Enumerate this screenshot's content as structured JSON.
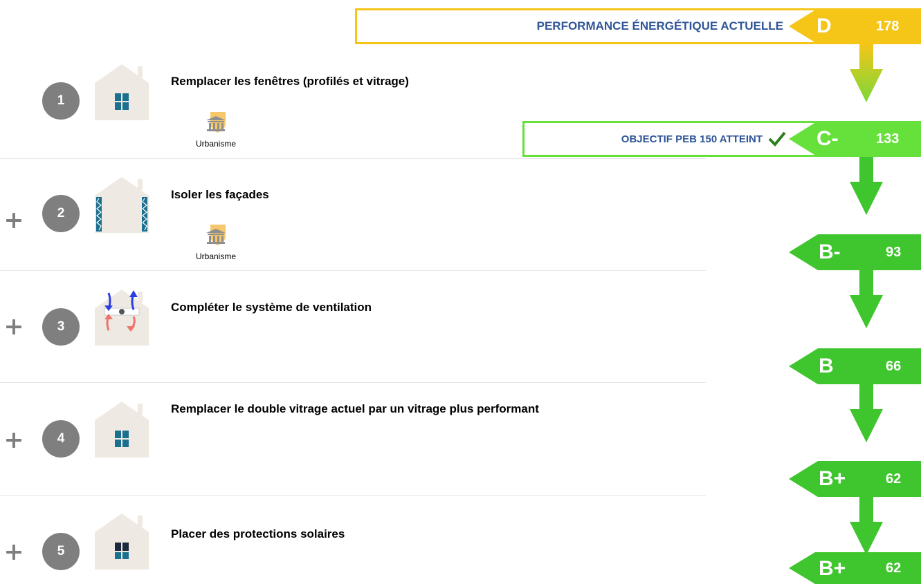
{
  "current": {
    "title": "PERFORMANCE ÉNERGÉTIQUE ACTUELLE",
    "label": "D",
    "value": "178",
    "color": "#f5c518"
  },
  "target": {
    "title": "OBJECTIF PEB 150 ATTEINT",
    "label": "C-",
    "value": "133",
    "color": "#66e03a"
  },
  "steps": [
    {
      "number": "1",
      "title": "Remplacer les fenêtres (profilés et vitrage)",
      "badge": "Urbanisme",
      "icon": "window-house-icon"
    },
    {
      "number": "2",
      "title": "Isoler les façades",
      "badge": "Urbanisme",
      "icon": "facade-insulation-house-icon"
    },
    {
      "number": "3",
      "title": "Compléter le système de ventilation",
      "icon": "ventilation-house-icon"
    },
    {
      "number": "4",
      "title": "Remplacer le double vitrage actuel par un vitrage plus performant",
      "icon": "glazing-house-icon"
    },
    {
      "number": "5",
      "title": "Placer des protections solaires",
      "icon": "sun-protection-house-icon"
    }
  ],
  "labels": [
    {
      "label": "B-",
      "value": "93"
    },
    {
      "label": "B",
      "value": "66"
    },
    {
      "label": "B+",
      "value": "62"
    },
    {
      "label": "B+",
      "value": "62"
    }
  ],
  "colors": {
    "green": "#3fc52d",
    "circle_gray": "#7f7f7f",
    "title_blue": "#2f5597",
    "house_wall": "#efe9e3",
    "window_blue": "#1b6f8f"
  }
}
